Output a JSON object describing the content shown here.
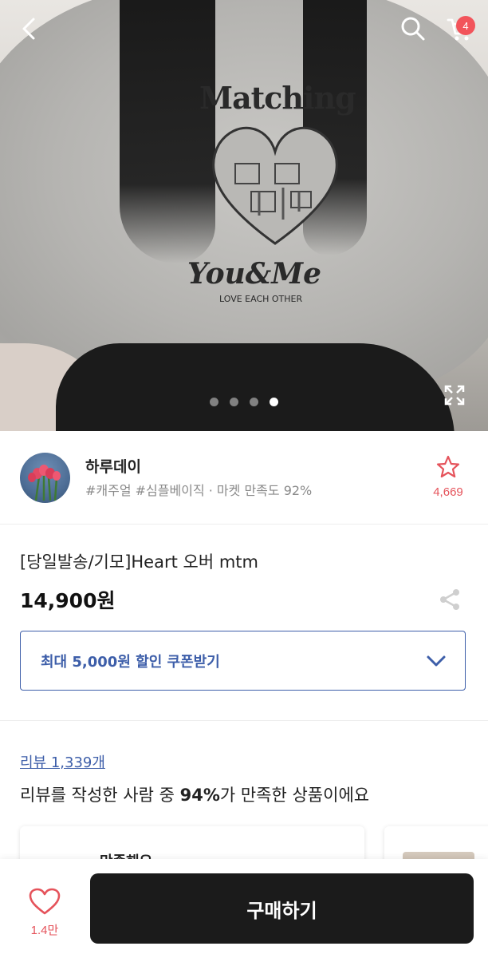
{
  "header": {
    "cart_badge": "4",
    "icons": [
      "back-icon",
      "search-icon",
      "cart-icon",
      "expand-icon"
    ]
  },
  "hero": {
    "print_top": "Matching",
    "print_mid": "You&Me",
    "print_small": "LOVE EACH OTHER",
    "carousel": {
      "count": 4,
      "active_index": 3
    }
  },
  "seller": {
    "name": "하루데이",
    "tags": "#캐주얼 #심플베이직 · 마켓 만족도 92%",
    "fav_count": "4,669"
  },
  "product": {
    "title": "[당일발송/기모]Heart 오버 mtm",
    "price": "14,900원"
  },
  "coupon": {
    "label": "최대 5,000원 할인 쿠폰받기"
  },
  "reviews": {
    "link": "리뷰 1,339개",
    "summary_prefix": "리뷰를 작성한 사람 중 ",
    "summary_percent": "94%",
    "summary_suffix": "가 만족한 상품이에요",
    "card_text": "만족해요"
  },
  "bottom_bar": {
    "like_count": "1.4만",
    "buy_label": "구매하기"
  },
  "colors": {
    "accent_blue": "#3d5ea9",
    "accent_red": "#e5535b",
    "buy_button": "#1b1b1b"
  }
}
